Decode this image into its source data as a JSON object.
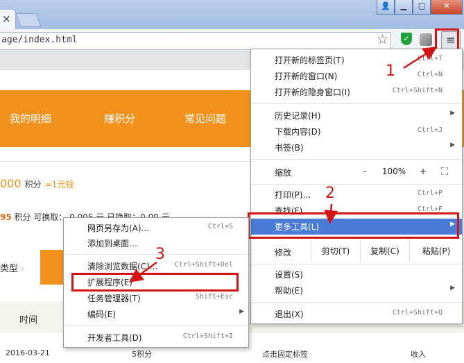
{
  "window": {
    "tab_close": "×",
    "buttons": {
      "user": "👤",
      "minimize": "▁",
      "maximize": "□",
      "close": "✕"
    }
  },
  "toolbar": {
    "url": "age/index.html",
    "icons": [
      "star-icon",
      "shield-icon",
      "extension-icon",
      "hamburger-menu-icon"
    ],
    "shield_glyph": "✓",
    "menu_glyph": "≡"
  },
  "page": {
    "nav": [
      "我的明细",
      "赚积分",
      "常见问题"
    ],
    "balance_num": "000",
    "balance_unit": "积分",
    "balance_eq": "=1元钱",
    "line2_num": "95",
    "line2_text": "积分  可换取：",
    "line2_partial": "0.005  元  已换取：0.00  元",
    "type_label": "类型",
    "table_header_time": "时间",
    "row": {
      "date": "2016-03-21",
      "points": "5积分",
      "desc": "点击固定标签",
      "type": "收入"
    }
  },
  "menu": {
    "group1": [
      {
        "label": "打开新的标签页(T)",
        "shortcut": "Ctrl+T"
      },
      {
        "label": "打开新的窗口(N)",
        "shortcut": "Ctrl+N"
      },
      {
        "label": "打开新的隐身窗口(I)",
        "shortcut": "Ctrl+Shift+N"
      }
    ],
    "group2": [
      {
        "label": "历史记录(H)",
        "shortcut": ""
      },
      {
        "label": "下载内容(D)",
        "shortcut": "Ctrl+J"
      },
      {
        "label": "书签(B)",
        "shortcut": ""
      }
    ],
    "zoom": {
      "label": "缩放",
      "minus": "-",
      "value": "100%",
      "plus": "+",
      "fullscreen": "⛶"
    },
    "group3": [
      {
        "label": "打印(P)...",
        "shortcut": "Ctrl+P"
      },
      {
        "label": "查找(F)...",
        "shortcut": "Ctrl+F"
      },
      {
        "label": "更多工具(L)",
        "shortcut": ""
      }
    ],
    "edit": {
      "label": "修改",
      "cut": "剪切(T)",
      "copy": "复制(C)",
      "paste": "粘贴(P)"
    },
    "group4": [
      {
        "label": "设置(S)",
        "shortcut": ""
      },
      {
        "label": "帮助(E)",
        "shortcut": ""
      }
    ],
    "exit": {
      "label": "退出(X)",
      "shortcut": "Ctrl+Shift+Q"
    },
    "arrow": "▶"
  },
  "submenu": {
    "items": [
      {
        "label": "网页另存为(A)...",
        "shortcut": "Ctrl+S"
      },
      {
        "label": "添加到桌面…",
        "shortcut": ""
      },
      {
        "label": "清除浏览数据(C)...",
        "shortcut": "Ctrl+Shift+Del"
      },
      {
        "label": "扩展程序(E)",
        "shortcut": ""
      },
      {
        "label": "任务管理器(T)",
        "shortcut": "Shift+Esc"
      },
      {
        "label": "编码(E)",
        "shortcut": ""
      },
      {
        "label": "开发者工具(D)",
        "shortcut": "Ctrl+Shift+I"
      }
    ]
  },
  "annotations": {
    "n1": "1",
    "n2": "2",
    "n3": "3",
    "color": "#d41414"
  },
  "colors": {
    "orange": "#f2911b",
    "menu_selected": "#4a7bd6",
    "highlight": "#d41414"
  }
}
